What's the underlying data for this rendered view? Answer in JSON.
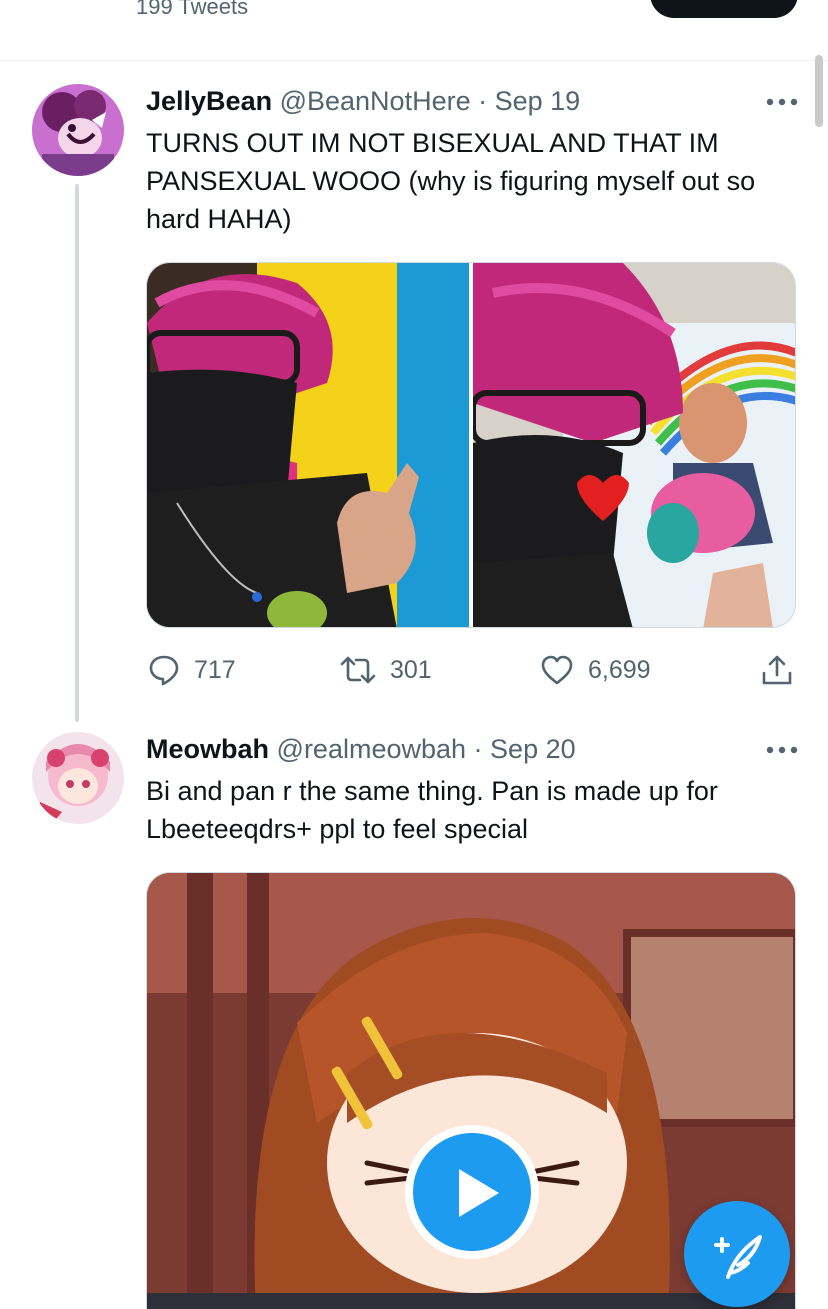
{
  "profile": {
    "tweet_count": "199 Tweets"
  },
  "tweets": [
    {
      "name": "JellyBean",
      "handle": "@BeanNotHere",
      "dot": " · ",
      "date": "Sep 19",
      "text": "TURNS OUT IM NOT BISEXUAL AND THAT IM PANSEXUAL WOOO (why is figuring myself out so hard HAHA)",
      "replies": "717",
      "retweets": "301",
      "likes": "6,699"
    },
    {
      "name": "Meowbah",
      "handle": "@realmeowbah",
      "dot": " · ",
      "date": "Sep 20",
      "text": "Bi and pan r the same thing. Pan is made up for Lbeeteeqdrs+ ppl to feel special"
    }
  ],
  "icons": {
    "reply": "reply-icon",
    "retweet": "retweet-icon",
    "like": "heart-icon",
    "share": "share-icon",
    "more": "more-icon",
    "play": "play-icon",
    "compose": "compose-tweet-icon"
  },
  "colors": {
    "accent": "#1d9bf0",
    "text": "#0f1419",
    "secondary": "#536471",
    "thread_line": "#cfd9de"
  }
}
